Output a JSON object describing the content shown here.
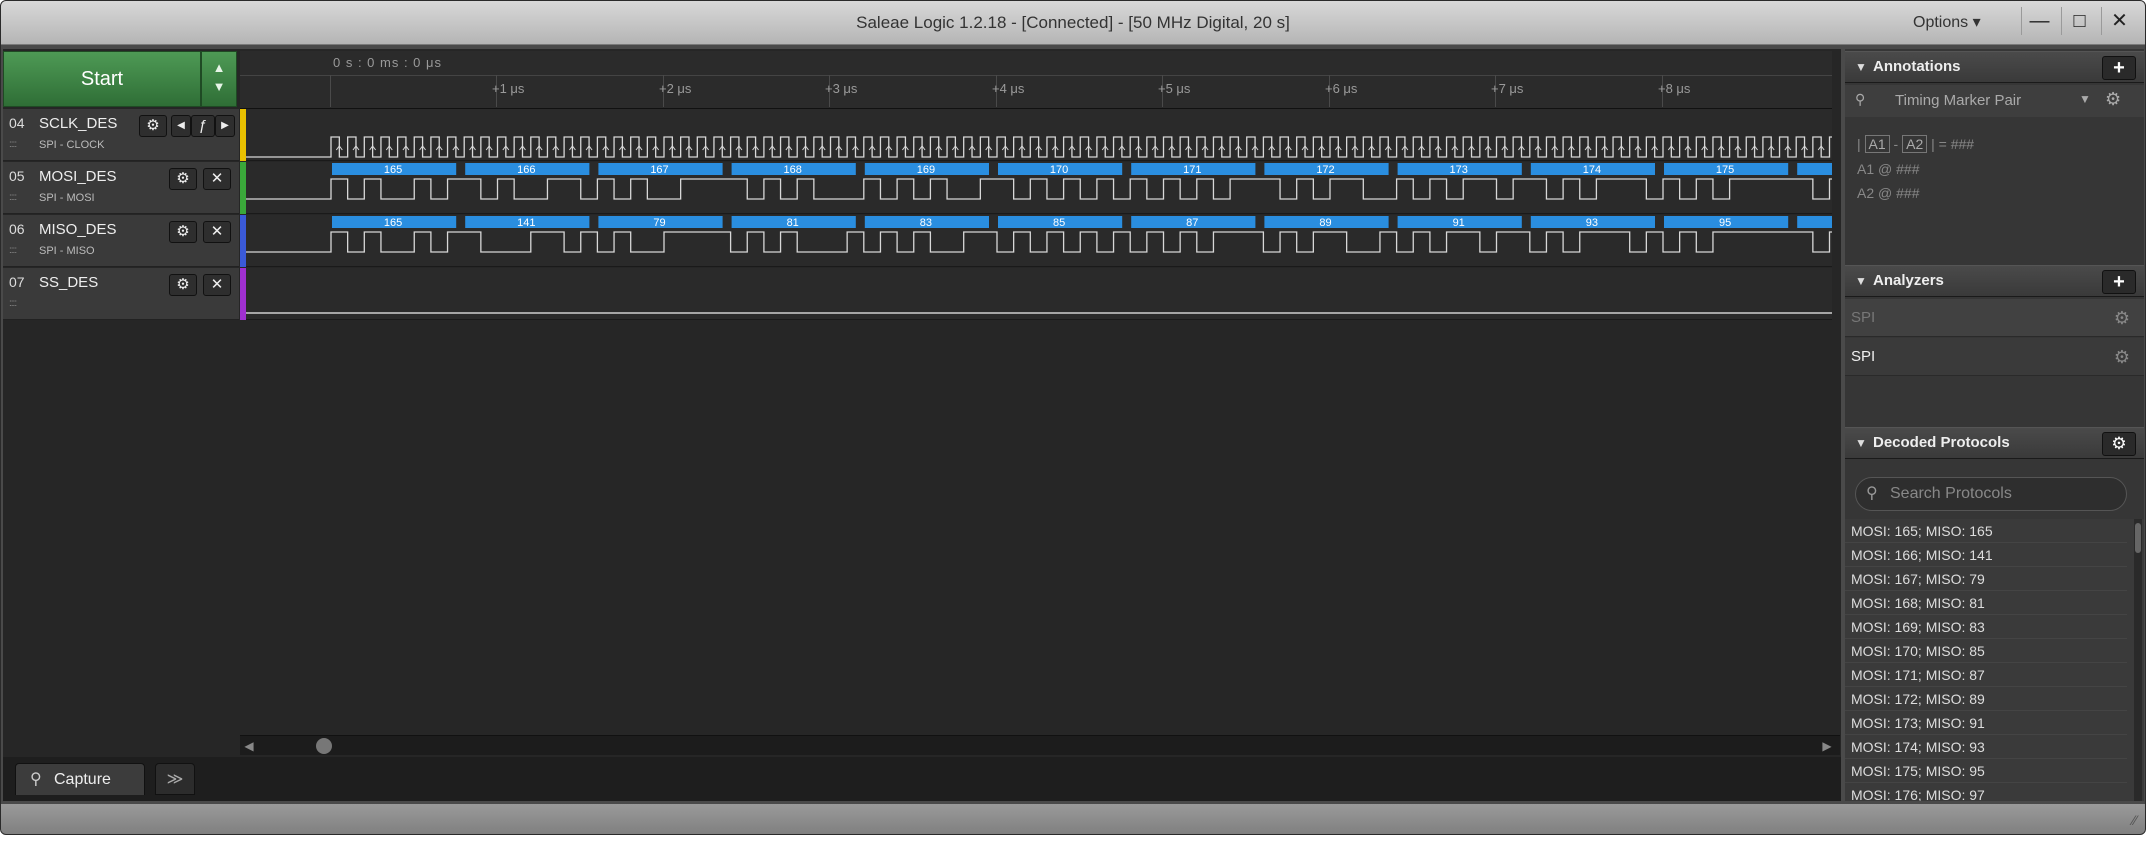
{
  "window": {
    "title": "Saleae Logic 1.2.18 - [Connected] - [50 MHz Digital, 20 s]",
    "options_label": "Options ▾",
    "minimize": "—",
    "maximize": "□",
    "close": "✕"
  },
  "toolbar": {
    "start_label": "Start",
    "arrow_up": "▲",
    "arrow_down": "▼"
  },
  "ruler": {
    "origin": "0 s : 0 ms : 0 μs",
    "ticks": [
      "+1 μs",
      "+2 μs",
      "+3 μs",
      "+4 μs",
      "+5 μs",
      "+6 μs",
      "+7 μs",
      "+8 μs"
    ]
  },
  "channels": [
    {
      "num": "04",
      "name": "SCLK_DES",
      "sub": "SPI - CLOCK",
      "color": "#e8c000"
    },
    {
      "num": "05",
      "name": "MOSI_DES",
      "sub": "SPI - MOSI",
      "color": "#3aa83a"
    },
    {
      "num": "06",
      "name": "MISO_DES",
      "sub": "SPI - MISO",
      "color": "#3a5ad8"
    },
    {
      "num": "07",
      "name": "SS_DES",
      "sub": "",
      "color": "#a030d0"
    }
  ],
  "channel_buttons": {
    "gear": "⚙",
    "close": "✕",
    "prev": "◀",
    "edge": "ƒ",
    "next": "▶",
    "grip": "::::"
  },
  "decoded": {
    "mosi_values": [
      "165",
      "166",
      "167",
      "168",
      "169",
      "170",
      "171",
      "172",
      "173",
      "174",
      "175"
    ],
    "miso_values": [
      "165",
      "141",
      "79",
      "81",
      "83",
      "85",
      "87",
      "89",
      "91",
      "93",
      "95"
    ],
    "bubble_color": "#2a8ee0"
  },
  "bottom": {
    "capture_label": "Capture",
    "capture_icon": "⚲",
    "more_label": "≫",
    "scroll_left": "◀",
    "scroll_right": "▶"
  },
  "annotations": {
    "header": "Annotations",
    "tri": "▼",
    "add": "+",
    "marker_label": "Timing Marker Pair",
    "marker_pin": "⚲",
    "marker_caret": "▼",
    "gear": "⚙",
    "line1_a1": "A1",
    "line1_sep": "-",
    "line1_a2": "A2",
    "line1_eq": "| = ###",
    "line1_bar": "|",
    "line2": "A1  @  ###",
    "line3": "A2  @  ###"
  },
  "analyzers": {
    "header": "Analyzers",
    "add": "+",
    "items": [
      "SPI",
      "SPI"
    ]
  },
  "decoded_protocols": {
    "header": "Decoded Protocols",
    "gear": "⚙",
    "search_placeholder": "Search Protocols",
    "search_icon": "⚲",
    "rows": [
      "MOSI: 165;  MISO: 165",
      "MOSI: 166;  MISO: 141",
      "MOSI: 167;  MISO: 79",
      "MOSI: 168;  MISO: 81",
      "MOSI: 169;  MISO: 83",
      "MOSI: 170;  MISO: 85",
      "MOSI: 171;  MISO: 87",
      "MOSI: 172;  MISO: 89",
      "MOSI: 173;  MISO: 91",
      "MOSI: 174;  MISO: 93",
      "MOSI: 175;  MISO: 95",
      "MOSI: 176;  MISO: 97"
    ]
  },
  "statusbar": {
    "grip": "⁄⁄"
  }
}
